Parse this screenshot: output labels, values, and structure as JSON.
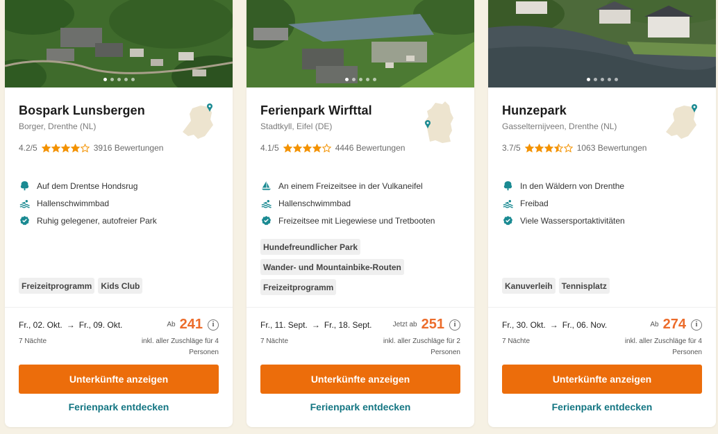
{
  "colors": {
    "accent_orange": "#ec6d0b",
    "price_orange": "#ec6c2b",
    "link_teal": "#137582",
    "icon_teal": "#1a8a92",
    "star_orange": "#f39200",
    "map_beige": "#ede4cf",
    "background": "#f6f1e4"
  },
  "cards": [
    {
      "title": "Bospark Lunsbergen",
      "location": "Borger, Drenthe (NL)",
      "map_icon": "netherlands-map-icon",
      "rating_text": "4.2/5",
      "stars": 4.2,
      "reviews": "3916 Bewertungen",
      "features": [
        {
          "icon": "tree-icon",
          "text": "Auf dem Drentse Hondsrug"
        },
        {
          "icon": "swimmer-icon",
          "text": "Hallenschwimmbad"
        },
        {
          "icon": "check-badge-icon",
          "text": "Ruhig gelegener, autofreier Park"
        }
      ],
      "tags": [
        "Freizeitprogramm",
        "Kids Club"
      ],
      "dates": {
        "from": "Fr., 02. Okt.",
        "to": "Fr., 09. Okt."
      },
      "price_prefix": "Ab",
      "price": "241",
      "nights": "7 Nächte",
      "surcharge": "inkl. aller Zuschläge für 4 Personen",
      "cta": "Unterkünfte anzeigen",
      "link": "Ferienpark entdecken"
    },
    {
      "title": "Ferienpark Wirfttal",
      "location": "Stadtkyll, Eifel (DE)",
      "map_icon": "germany-map-icon",
      "rating_text": "4.1/5",
      "stars": 4.1,
      "reviews": "4446 Bewertungen",
      "features": [
        {
          "icon": "sailboat-icon",
          "text": "An einem Freizeitsee in der Vulkaneifel"
        },
        {
          "icon": "swimmer-icon",
          "text": "Hallenschwimmbad"
        },
        {
          "icon": "check-badge-icon",
          "text": "Freizeitsee mit Liegewiese und Tretbooten"
        }
      ],
      "tags": [
        "Hundefreundlicher Park",
        "Wander- und Mountainbike-Routen",
        "Freizeitprogramm"
      ],
      "dates": {
        "from": "Fr., 11. Sept.",
        "to": "Fr., 18. Sept."
      },
      "price_prefix": "Jetzt ab",
      "price": "251",
      "nights": "7 Nächte",
      "surcharge": "inkl. aller Zuschläge für 2 Personen",
      "cta": "Unterkünfte anzeigen",
      "link": "Ferienpark entdecken"
    },
    {
      "title": "Hunzepark",
      "location": "Gasselternijveen, Drenthe (NL)",
      "map_icon": "netherlands-map-icon",
      "rating_text": "3.7/5",
      "stars": 3.7,
      "reviews": "1063 Bewertungen",
      "features": [
        {
          "icon": "tree-icon",
          "text": "In den Wäldern von Drenthe"
        },
        {
          "icon": "swimmer-icon",
          "text": "Freibad"
        },
        {
          "icon": "check-badge-icon",
          "text": "Viele Wassersportaktivitäten"
        }
      ],
      "tags": [
        "Kanuverleih",
        "Tennisplatz"
      ],
      "dates": {
        "from": "Fr., 30. Okt.",
        "to": "Fr., 06. Nov."
      },
      "price_prefix": "Ab",
      "price": "274",
      "nights": "7 Nächte",
      "surcharge": "inkl. aller Zuschläge für 4 Personen",
      "cta": "Unterkünfte anzeigen",
      "link": "Ferienpark entdecken"
    }
  ]
}
